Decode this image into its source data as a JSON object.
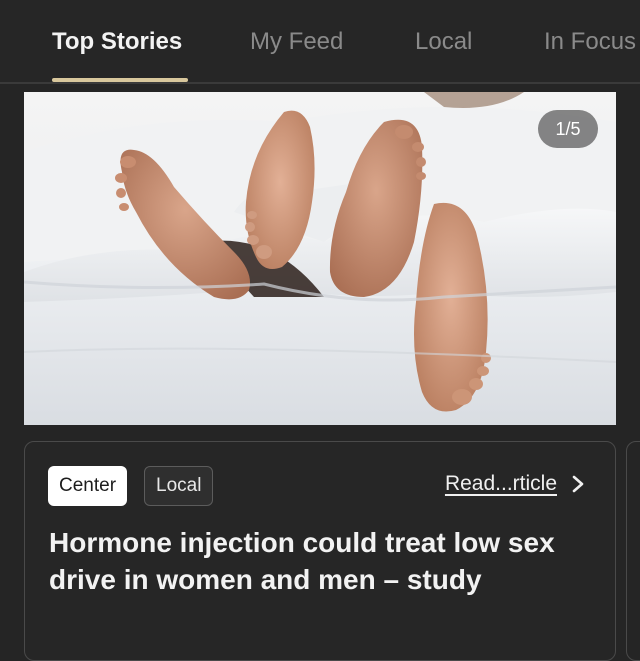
{
  "tabs": [
    {
      "label": "Top Stories",
      "active": true
    },
    {
      "label": "My Feed",
      "active": false
    },
    {
      "label": "Local",
      "active": false
    },
    {
      "label": "In Focus",
      "active": false
    }
  ],
  "hero": {
    "counter": "1/5"
  },
  "article": {
    "tags": [
      "Center",
      "Local"
    ],
    "read_label": "Read...rticle",
    "headline": "Hormone injection could treat low sex drive in women and men – study"
  },
  "colors": {
    "background": "#252525",
    "tab_underline": "#d8c79c",
    "tag_center_bg": "#ffffff"
  },
  "icons": {
    "read_link": "chevron-right-icon"
  }
}
